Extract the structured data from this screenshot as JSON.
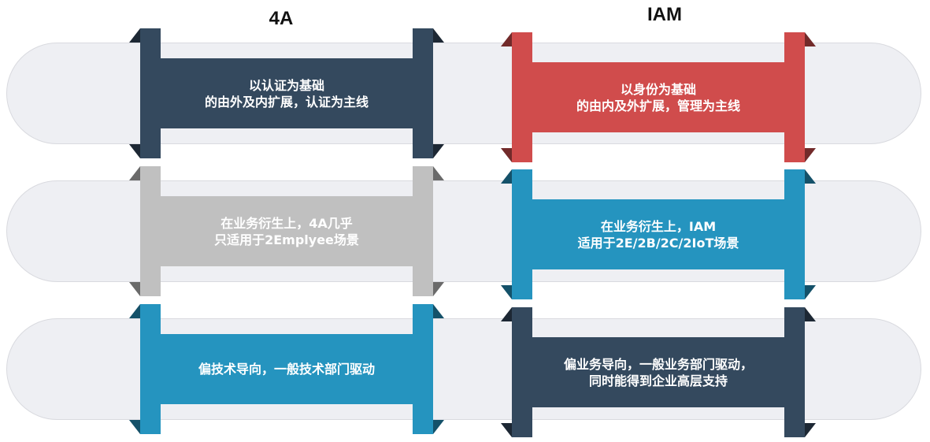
{
  "columns": [
    {
      "title": "4A"
    },
    {
      "title": "IAM"
    }
  ],
  "rows": [
    {
      "left": {
        "lines": [
          "以认证为基础",
          "的由外及内扩展，认证为主线"
        ],
        "color": "#34495e"
      },
      "right": {
        "lines": [
          "以身份为基础",
          "的由内及外扩展，管理为主线"
        ],
        "color": "#d04c4c"
      }
    },
    {
      "left": {
        "lines": [
          "在业务衍生上，4A几乎",
          "只适用于2Emplyee场景"
        ],
        "color": "#c0c0c0"
      },
      "right": {
        "lines": [
          "在业务衍生上，IAM",
          "适用于2E/2B/2C/2IoT场景"
        ],
        "color": "#2594bf"
      }
    },
    {
      "left": {
        "lines": [
          "偏技术导向，一般技术部门驱动"
        ],
        "color": "#2594bf"
      },
      "right": {
        "lines": [
          "偏业务导向，一般业务部门驱动，",
          "同时能得到企业高层支持"
        ],
        "color": "#34495e"
      }
    }
  ]
}
